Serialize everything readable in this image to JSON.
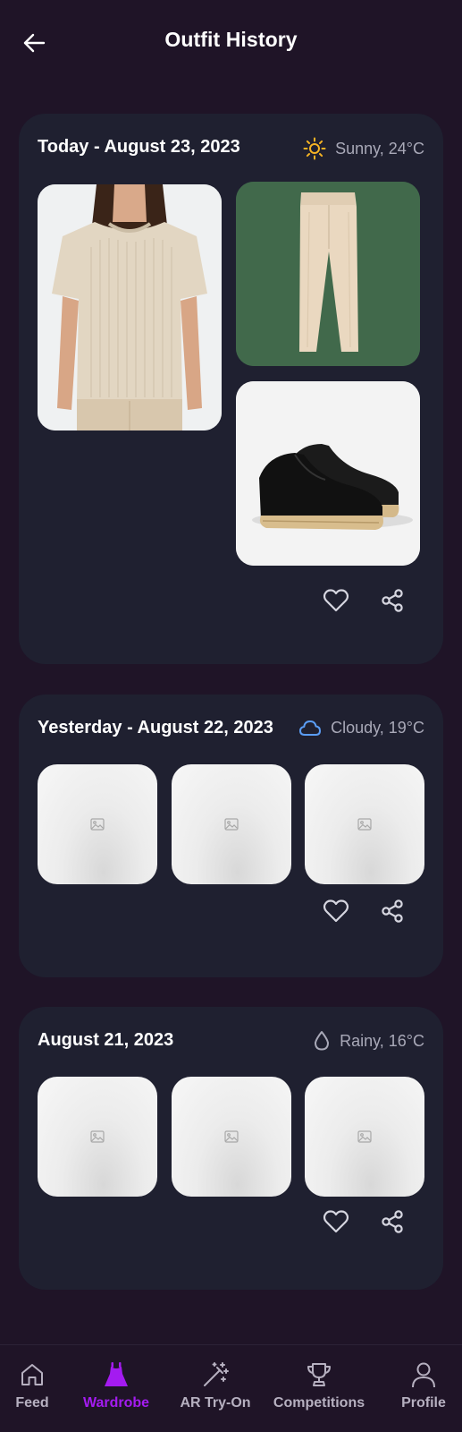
{
  "header": {
    "title": "Outfit History"
  },
  "outfits": [
    {
      "date": "Today - August 23, 2023",
      "weather": {
        "label": "Sunny, 24°C",
        "icon": "sun-icon",
        "color": "#f5b324"
      },
      "items": [
        {
          "icon": "sweater-photo",
          "desc": ""
        },
        {
          "icon": "pants-photo",
          "desc": ""
        },
        {
          "icon": "shoes-photo",
          "desc": ""
        }
      ]
    },
    {
      "date": "Yesterday - August 22, 2023",
      "weather": {
        "label": "Cloudy, 19°C",
        "icon": "cloud-icon",
        "color": "#5b9df5"
      },
      "items": [
        {
          "icon": "image-placeholder-icon"
        },
        {
          "icon": "image-placeholder-icon"
        },
        {
          "icon": "image-placeholder-icon"
        }
      ]
    },
    {
      "date": "August 21, 2023",
      "weather": {
        "label": "Rainy, 16°C",
        "icon": "droplet-icon",
        "color": "#a9a9b8"
      },
      "items": [
        {
          "icon": "image-placeholder-icon"
        },
        {
          "icon": "image-placeholder-icon"
        },
        {
          "icon": "image-placeholder-icon"
        }
      ]
    }
  ],
  "nav": {
    "items": [
      {
        "label": "Feed",
        "icon": "home-icon"
      },
      {
        "label": "Wardrobe",
        "icon": "dress-icon",
        "active": true
      },
      {
        "label": "AR Try-On",
        "icon": "magic-wand-icon"
      },
      {
        "label": "Competitions",
        "icon": "trophy-icon"
      },
      {
        "label": "Profile",
        "icon": "user-icon"
      }
    ]
  },
  "colors": {
    "background": "#1f1427",
    "card": "#1f2030",
    "accent": "#a41bf0",
    "muted": "#a9a9b8"
  }
}
